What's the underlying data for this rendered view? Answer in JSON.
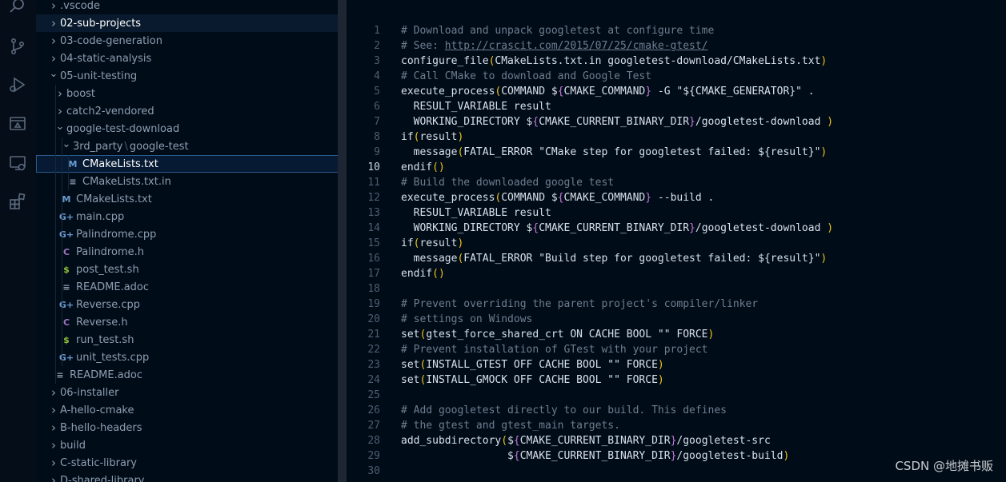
{
  "activity_bar": {
    "icons": [
      "search-icon",
      "source-control-icon",
      "run-debug-icon",
      "remote-explorer-icon",
      "remote-icon",
      "extensions-icon"
    ]
  },
  "explorer": {
    "rows": [
      {
        "label": ".vscode",
        "type": "folder",
        "expanded": false,
        "depth": 0,
        "icon": ""
      },
      {
        "label": "02-sub-projects",
        "type": "folder",
        "expanded": false,
        "depth": 0,
        "icon": "",
        "state": "selected"
      },
      {
        "label": "03-code-generation",
        "type": "folder",
        "expanded": false,
        "depth": 0,
        "icon": ""
      },
      {
        "label": "04-static-analysis",
        "type": "folder",
        "expanded": false,
        "depth": 0,
        "icon": ""
      },
      {
        "label": "05-unit-testing",
        "type": "folder",
        "expanded": true,
        "depth": 0,
        "icon": ""
      },
      {
        "label": "boost",
        "type": "folder",
        "expanded": false,
        "depth": 1,
        "icon": ""
      },
      {
        "label": "catch2-vendored",
        "type": "folder",
        "expanded": false,
        "depth": 1,
        "icon": ""
      },
      {
        "label": "google-test-download",
        "type": "folder",
        "expanded": true,
        "depth": 1,
        "icon": ""
      },
      {
        "label": "3rd_party",
        "type": "folder",
        "expanded": true,
        "depth": 2,
        "icon": "",
        "suffix": "google-test",
        "separator": "\\"
      },
      {
        "label": "CMakeLists.txt",
        "type": "file",
        "depth": 3,
        "icon": "M",
        "icon_class": "cmake",
        "state": "active"
      },
      {
        "label": "CMakeLists.txt.in",
        "type": "file",
        "depth": 3,
        "icon": "≡",
        "icon_class": "lines"
      },
      {
        "label": "CMakeLists.txt",
        "type": "file",
        "depth": 2,
        "icon": "M",
        "icon_class": "cmake"
      },
      {
        "label": "main.cpp",
        "type": "file",
        "depth": 2,
        "icon": "G+",
        "icon_class": "cpp"
      },
      {
        "label": "Palindrome.cpp",
        "type": "file",
        "depth": 2,
        "icon": "G+",
        "icon_class": "cpp"
      },
      {
        "label": "Palindrome.h",
        "type": "file",
        "depth": 2,
        "icon": "C",
        "icon_class": "h"
      },
      {
        "label": "post_test.sh",
        "type": "file",
        "depth": 2,
        "icon": "$",
        "icon_class": "sh"
      },
      {
        "label": "README.adoc",
        "type": "file",
        "depth": 2,
        "icon": "≡",
        "icon_class": "lines"
      },
      {
        "label": "Reverse.cpp",
        "type": "file",
        "depth": 2,
        "icon": "G+",
        "icon_class": "cpp"
      },
      {
        "label": "Reverse.h",
        "type": "file",
        "depth": 2,
        "icon": "C",
        "icon_class": "h"
      },
      {
        "label": "run_test.sh",
        "type": "file",
        "depth": 2,
        "icon": "$",
        "icon_class": "sh"
      },
      {
        "label": "unit_tests.cpp",
        "type": "file",
        "depth": 2,
        "icon": "G+",
        "icon_class": "cpp"
      },
      {
        "label": "README.adoc",
        "type": "file",
        "depth": 1,
        "icon": "≡",
        "icon_class": "lines"
      },
      {
        "label": "06-installer",
        "type": "folder",
        "expanded": false,
        "depth": 0,
        "icon": ""
      },
      {
        "label": "A-hello-cmake",
        "type": "folder",
        "expanded": false,
        "depth": 0,
        "icon": ""
      },
      {
        "label": "B-hello-headers",
        "type": "folder",
        "expanded": false,
        "depth": 0,
        "icon": ""
      },
      {
        "label": "build",
        "type": "folder",
        "expanded": false,
        "depth": 0,
        "icon": ""
      },
      {
        "label": "C-static-library",
        "type": "folder",
        "expanded": false,
        "depth": 0,
        "icon": ""
      },
      {
        "label": "D-shared-library",
        "type": "folder",
        "expanded": false,
        "depth": 0,
        "icon": ""
      }
    ]
  },
  "editor": {
    "current_line": 10,
    "lines": [
      {
        "n": "1",
        "tokens": [
          {
            "c": "comment",
            "t": "# Download and unpack googletest at configure time"
          }
        ]
      },
      {
        "n": "2",
        "tokens": [
          {
            "c": "comment",
            "t": "# See: "
          },
          {
            "c": "url",
            "t": "http://crascit.com/2015/07/25/cmake-gtest/"
          }
        ]
      },
      {
        "n": "3",
        "tokens": [
          {
            "c": "kw",
            "t": "configure_file"
          },
          {
            "c": "paren",
            "t": "("
          },
          {
            "c": "kw",
            "t": "CMakeLists.txt.in googletest-download/CMakeLists.txt"
          },
          {
            "c": "paren",
            "t": ")"
          }
        ]
      },
      {
        "n": "4",
        "tokens": [
          {
            "c": "comment",
            "t": "# Call CMake to download and Google Test"
          }
        ]
      },
      {
        "n": "5",
        "tokens": [
          {
            "c": "kw",
            "t": "execute_process"
          },
          {
            "c": "paren",
            "t": "("
          },
          {
            "c": "kw",
            "t": "COMMAND $"
          },
          {
            "c": "brace",
            "t": "{"
          },
          {
            "c": "kw",
            "t": "CMAKE_COMMAND"
          },
          {
            "c": "brace",
            "t": "}"
          },
          {
            "c": "kw",
            "t": " -G \"${CMAKE_GENERATOR}\" ."
          }
        ]
      },
      {
        "n": "6",
        "tokens": [
          {
            "c": "kw",
            "t": "  RESULT_VARIABLE result"
          }
        ]
      },
      {
        "n": "7",
        "tokens": [
          {
            "c": "kw",
            "t": "  WORKING_DIRECTORY $"
          },
          {
            "c": "brace",
            "t": "{"
          },
          {
            "c": "kw",
            "t": "CMAKE_CURRENT_BINARY_DIR"
          },
          {
            "c": "brace",
            "t": "}"
          },
          {
            "c": "kw",
            "t": "/googletest-download "
          },
          {
            "c": "paren",
            "t": ")"
          }
        ]
      },
      {
        "n": "8",
        "tokens": [
          {
            "c": "kw",
            "t": "if"
          },
          {
            "c": "paren",
            "t": "("
          },
          {
            "c": "kw",
            "t": "result"
          },
          {
            "c": "paren",
            "t": ")"
          }
        ]
      },
      {
        "n": "9",
        "tokens": [
          {
            "c": "kw",
            "t": "  message"
          },
          {
            "c": "paren",
            "t": "("
          },
          {
            "c": "kw",
            "t": "FATAL_ERROR \"CMake step for googletest failed: ${result}\""
          },
          {
            "c": "paren",
            "t": ")"
          }
        ]
      },
      {
        "n": "10",
        "tokens": [
          {
            "c": "kw",
            "t": "endif"
          },
          {
            "c": "paren",
            "t": "()"
          }
        ]
      },
      {
        "n": "11",
        "tokens": [
          {
            "c": "comment",
            "t": "# Build the downloaded google test"
          }
        ]
      },
      {
        "n": "12",
        "tokens": [
          {
            "c": "kw",
            "t": "execute_process"
          },
          {
            "c": "paren",
            "t": "("
          },
          {
            "c": "kw",
            "t": "COMMAND $"
          },
          {
            "c": "brace",
            "t": "{"
          },
          {
            "c": "kw",
            "t": "CMAKE_COMMAND"
          },
          {
            "c": "brace",
            "t": "}"
          },
          {
            "c": "kw",
            "t": " --build ."
          }
        ]
      },
      {
        "n": "13",
        "tokens": [
          {
            "c": "kw",
            "t": "  RESULT_VARIABLE result"
          }
        ]
      },
      {
        "n": "14",
        "tokens": [
          {
            "c": "kw",
            "t": "  WORKING_DIRECTORY $"
          },
          {
            "c": "brace",
            "t": "{"
          },
          {
            "c": "kw",
            "t": "CMAKE_CURRENT_BINARY_DIR"
          },
          {
            "c": "brace",
            "t": "}"
          },
          {
            "c": "kw",
            "t": "/googletest-download "
          },
          {
            "c": "paren",
            "t": ")"
          }
        ]
      },
      {
        "n": "15",
        "tokens": [
          {
            "c": "kw",
            "t": "if"
          },
          {
            "c": "paren",
            "t": "("
          },
          {
            "c": "kw",
            "t": "result"
          },
          {
            "c": "paren",
            "t": ")"
          }
        ]
      },
      {
        "n": "16",
        "tokens": [
          {
            "c": "kw",
            "t": "  message"
          },
          {
            "c": "paren",
            "t": "("
          },
          {
            "c": "kw",
            "t": "FATAL_ERROR \"Build step for googletest failed: ${result}\""
          },
          {
            "c": "paren",
            "t": ")"
          }
        ]
      },
      {
        "n": "17",
        "tokens": [
          {
            "c": "kw",
            "t": "endif"
          },
          {
            "c": "paren",
            "t": "()"
          }
        ]
      },
      {
        "n": "18",
        "tokens": []
      },
      {
        "n": "19",
        "tokens": [
          {
            "c": "comment",
            "t": "# Prevent overriding the parent project's compiler/linker"
          }
        ]
      },
      {
        "n": "20",
        "tokens": [
          {
            "c": "comment",
            "t": "# settings on Windows"
          }
        ]
      },
      {
        "n": "21",
        "tokens": [
          {
            "c": "kw",
            "t": "set"
          },
          {
            "c": "paren",
            "t": "("
          },
          {
            "c": "kw",
            "t": "gtest_force_shared_crt ON CACHE BOOL \"\" FORCE"
          },
          {
            "c": "paren",
            "t": ")"
          }
        ]
      },
      {
        "n": "22",
        "tokens": [
          {
            "c": "comment",
            "t": "# Prevent installation of GTest with your project"
          }
        ]
      },
      {
        "n": "23",
        "tokens": [
          {
            "c": "kw",
            "t": "set"
          },
          {
            "c": "paren",
            "t": "("
          },
          {
            "c": "kw",
            "t": "INSTALL_GTEST OFF CACHE BOOL \"\" FORCE"
          },
          {
            "c": "paren",
            "t": ")"
          }
        ]
      },
      {
        "n": "24",
        "tokens": [
          {
            "c": "kw",
            "t": "set"
          },
          {
            "c": "paren",
            "t": "("
          },
          {
            "c": "kw",
            "t": "INSTALL_GMOCK OFF CACHE BOOL \"\" FORCE"
          },
          {
            "c": "paren",
            "t": ")"
          }
        ]
      },
      {
        "n": "25",
        "tokens": []
      },
      {
        "n": "26",
        "tokens": [
          {
            "c": "comment",
            "t": "# Add googletest directly to our build. This defines"
          }
        ]
      },
      {
        "n": "27",
        "tokens": [
          {
            "c": "comment",
            "t": "# the gtest and gtest_main targets."
          }
        ]
      },
      {
        "n": "28",
        "tokens": [
          {
            "c": "kw",
            "t": "add_subdirectory"
          },
          {
            "c": "paren",
            "t": "("
          },
          {
            "c": "kw",
            "t": "$"
          },
          {
            "c": "brace",
            "t": "{"
          },
          {
            "c": "kw",
            "t": "CMAKE_CURRENT_BINARY_DIR"
          },
          {
            "c": "brace",
            "t": "}"
          },
          {
            "c": "kw",
            "t": "/googletest-src"
          }
        ]
      },
      {
        "n": "29",
        "tokens": [
          {
            "c": "kw",
            "t": "                 $"
          },
          {
            "c": "brace",
            "t": "{"
          },
          {
            "c": "kw",
            "t": "CMAKE_CURRENT_BINARY_DIR"
          },
          {
            "c": "brace",
            "t": "}"
          },
          {
            "c": "kw",
            "t": "/googletest-build"
          },
          {
            "c": "paren",
            "t": ")"
          }
        ]
      },
      {
        "n": "30",
        "tokens": []
      }
    ]
  },
  "watermark": "CSDN @地摊书贩"
}
